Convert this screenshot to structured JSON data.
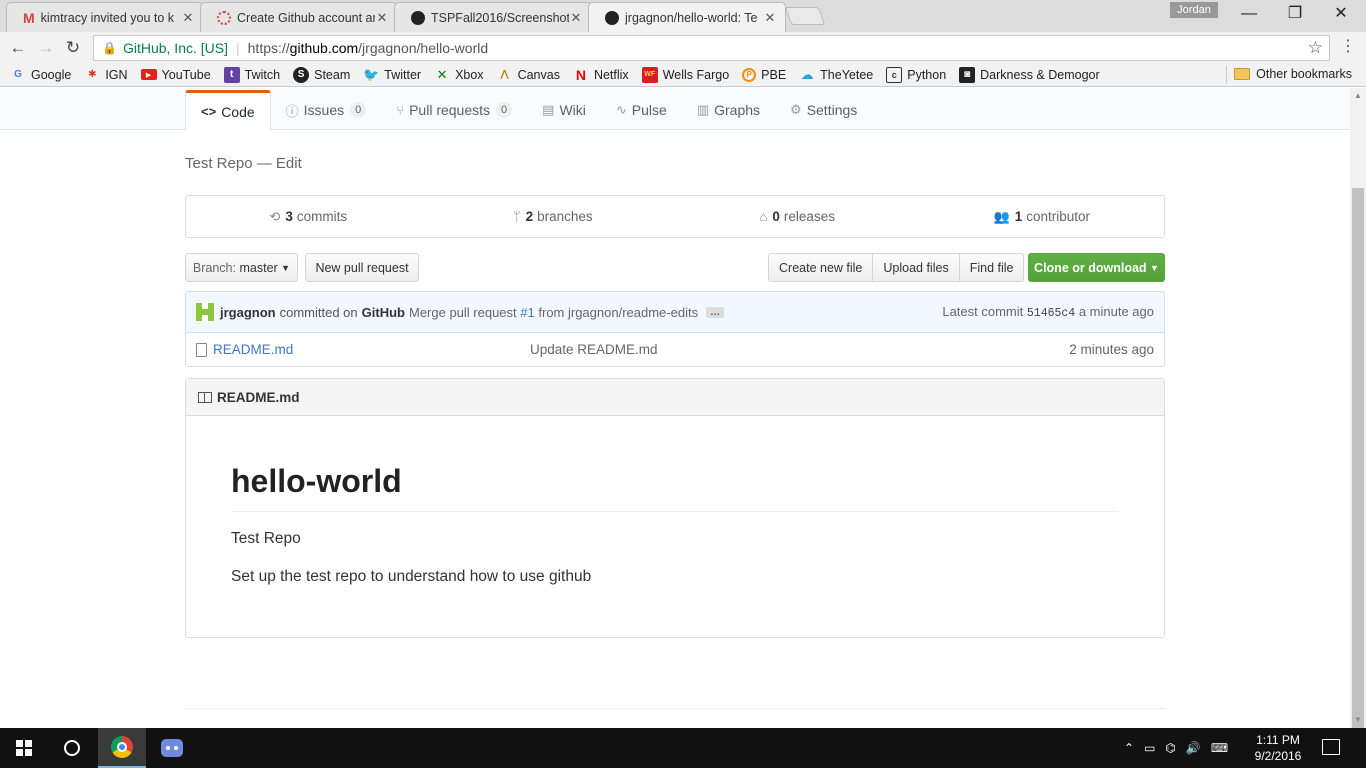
{
  "browser": {
    "tabs": [
      {
        "title": "kimtracy invited you to k",
        "icon": "gmail-icon",
        "active": false
      },
      {
        "title": "Create Github account ar",
        "icon": "loading-icon",
        "active": false
      },
      {
        "title": "TSPFall2016/Screenshot_",
        "icon": "github-icon",
        "active": false
      },
      {
        "title": "jrgagnon/hello-world: Te",
        "icon": "github-icon",
        "active": true
      }
    ],
    "profile_name": "Jordan",
    "window_controls": {
      "minimize": "—",
      "restore": "❐",
      "close": "✕"
    },
    "address": {
      "secure_label": "GitHub, Inc. [US]",
      "url_scheme": "https://",
      "url_host": "github.com",
      "url_path": "/jrgagnon/hello-world"
    },
    "bookmarks": [
      {
        "label": "Google",
        "icon": "google-icon"
      },
      {
        "label": "IGN",
        "icon": "ign-icon"
      },
      {
        "label": "YouTube",
        "icon": "youtube-icon"
      },
      {
        "label": "Twitch",
        "icon": "twitch-icon"
      },
      {
        "label": "Steam",
        "icon": "steam-icon"
      },
      {
        "label": "Twitter",
        "icon": "twitter-icon"
      },
      {
        "label": "Xbox",
        "icon": "xbox-icon"
      },
      {
        "label": "Canvas",
        "icon": "canvas-icon"
      },
      {
        "label": "Netflix",
        "icon": "netflix-icon"
      },
      {
        "label": "Wells Fargo",
        "icon": "wells-fargo-icon"
      },
      {
        "label": "PBE",
        "icon": "pbe-icon"
      },
      {
        "label": "TheYetee",
        "icon": "theyetee-icon"
      },
      {
        "label": "Python",
        "icon": "python-icon"
      },
      {
        "label": "Darkness & Demogor",
        "icon": "darkness-icon"
      }
    ],
    "other_bookmarks": "Other bookmarks"
  },
  "repo": {
    "nav": [
      {
        "label": "Code",
        "icon": "code-icon",
        "selected": true
      },
      {
        "label": "Issues",
        "icon": "issue-icon",
        "count": "0"
      },
      {
        "label": "Pull requests",
        "icon": "pull-request-icon",
        "count": "0"
      },
      {
        "label": "Wiki",
        "icon": "wiki-icon"
      },
      {
        "label": "Pulse",
        "icon": "pulse-icon"
      },
      {
        "label": "Graphs",
        "icon": "graph-icon"
      },
      {
        "label": "Settings",
        "icon": "gear-icon"
      }
    ],
    "description": "Test Repo",
    "description_sep": " — ",
    "edit_label": "Edit",
    "summary": {
      "commits_num": "3",
      "commits_label": "commits",
      "branches_num": "2",
      "branches_label": "branches",
      "releases_num": "0",
      "releases_label": "releases",
      "contributors_num": "1",
      "contributors_label": "contributor"
    },
    "branch_prefix": "Branch:",
    "branch_name": "master",
    "new_pull_request": "New pull request",
    "create_new_file": "Create new file",
    "upload_files": "Upload files",
    "find_file": "Find file",
    "clone_or_download": "Clone or download",
    "commit": {
      "author": "jrgagnon",
      "committed_on": "committed on",
      "committer": "GitHub",
      "message_prefix": "Merge pull request",
      "pr_link": "#1",
      "message_suffix": "from jrgagnon/readme-edits",
      "ellipsis": "…",
      "latest_label": "Latest commit",
      "sha": "51465c4",
      "time": "a minute ago"
    },
    "files": [
      {
        "name": "README.md",
        "message": "Update README.md",
        "age": "2 minutes ago"
      }
    ],
    "readme": {
      "header": "README.md",
      "heading": "hello-world",
      "paragraphs": [
        "Test Repo",
        "Set up the test repo to understand how to use github"
      ]
    }
  },
  "taskbar": {
    "time": "1:11 PM",
    "date": "9/2/2016"
  },
  "colors": {
    "selected_tab_accent": "#e36209",
    "link": "#4078c0",
    "primary_button": "#60b044",
    "commit_bar_bg": "#f1f8ff"
  }
}
